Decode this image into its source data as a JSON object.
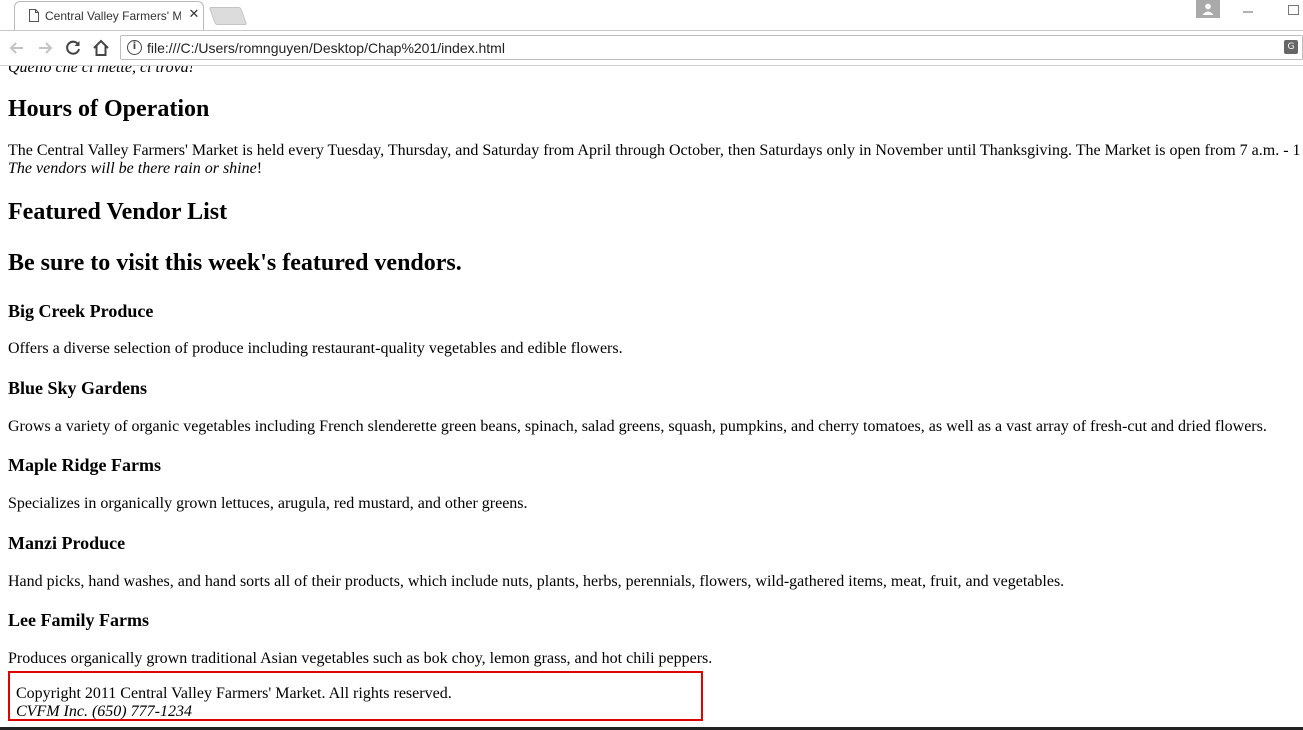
{
  "browser": {
    "tab_title": "Central Valley Farmers' M",
    "url": "file:///C:/Users/romnguyen/Desktop/Chap%201/index.html"
  },
  "page": {
    "motto": "Quello che ci mette, ci trova!",
    "hours_heading": "Hours of Operation",
    "hours_text": "The Central Valley Farmers' Market is held every Tuesday, Thursday, and Saturday from April through October, then Saturdays only in November until Thanksgiving. The Market is open from 7 a.m. - 1",
    "hours_italic": "The vendors will be there rain or shine",
    "hours_exclaim": "!",
    "vendor_heading": "Featured Vendor List",
    "vendor_subheading": "Be sure to visit this week's featured vendors.",
    "vendors": [
      {
        "name": "Big Creek Produce",
        "desc": "Offers a diverse selection of produce including restaurant-quality vegetables and edible flowers."
      },
      {
        "name": "Blue Sky Gardens",
        "desc": "Grows a variety of organic vegetables including French slenderette green beans, spinach, salad greens, squash, pumpkins, and cherry tomatoes, as well as a vast array of fresh-cut and dried flowers."
      },
      {
        "name": "Maple Ridge Farms",
        "desc": "Specializes in organically grown lettuces, arugula, red mustard, and other greens."
      },
      {
        "name": "Manzi Produce",
        "desc": "Hand picks, hand washes, and hand sorts all of their products, which include nuts, plants, herbs, perennials, flowers, wild-gathered items, meat, fruit, and vegetables."
      },
      {
        "name": "Lee Family Farms",
        "desc": "Produces organically grown traditional Asian vegetables such as bok choy, lemon grass, and hot chili peppers."
      }
    ],
    "footer": {
      "copyright": "Copyright 2011 Central Valley Farmers' Market. All rights reserved.",
      "contact": "CVFM Inc. (650) 777-1234"
    }
  }
}
